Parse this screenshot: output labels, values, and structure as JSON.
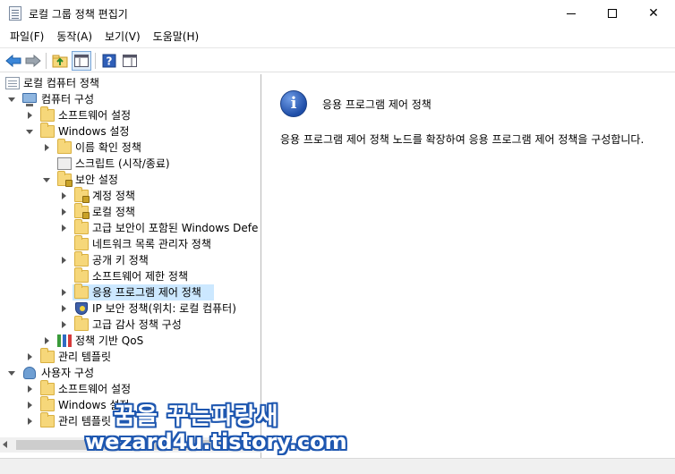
{
  "window": {
    "title": "로컬 그룹 정책 편집기"
  },
  "menu": [
    {
      "label": "파일(F)"
    },
    {
      "label": "동작(A)"
    },
    {
      "label": "보기(V)"
    },
    {
      "label": "도움말(H)"
    }
  ],
  "tree": {
    "root": "로컬 컴퓨터 정책",
    "computer_config": "컴퓨터 구성",
    "cc_software": "소프트웨어 설정",
    "cc_windows": "Windows 설정",
    "name_resolution": "이름 확인 정책",
    "scripts": "스크립트 (시작/종료)",
    "security": "보안 설정",
    "account_policies": "계정 정책",
    "local_policies": "로컬 정책",
    "firewall": "고급 보안이 포함된 Windows Defe",
    "network_list": "네트워크 목록 관리자 정책",
    "public_key": "공개 키 정책",
    "software_restriction": "소프트웨어 제한 정책",
    "app_control": "응용 프로그램 제어 정책",
    "ipsec": "IP 보안 정책(위치: 로컬 컴퓨터)",
    "audit": "고급 감사 정책 구성",
    "qos": "정책 기반 QoS",
    "cc_admin_templates": "관리 템플릿",
    "user_config": "사용자 구성",
    "uc_software": "소프트웨어 설정",
    "uc_windows": "Windows 설정",
    "uc_admin_templates": "관리 템플릿"
  },
  "detail": {
    "title": "응용 프로그램 제어 정책",
    "description": "응용 프로그램 제어 정책 노드를 확장하여 응용 프로그램 제어 정책을 구성합니다."
  },
  "watermark": {
    "line1": "꿈을 꾸는파랑새",
    "line2": "wezard4u.tistory.com"
  },
  "colors": {
    "selection": "#cce8ff",
    "accent": "#1e57b0"
  }
}
